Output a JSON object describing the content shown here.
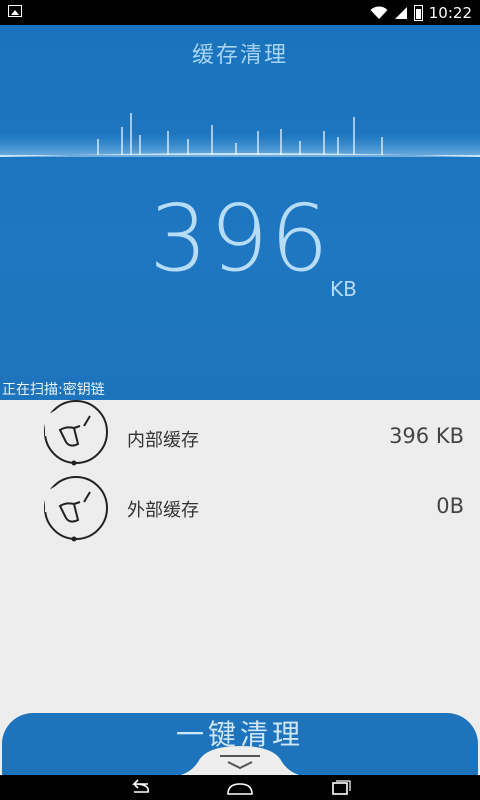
{
  "status_bar": {
    "time": "10:22"
  },
  "header": {
    "title": "缓存清理",
    "size_value": "396",
    "size_unit": "KB",
    "scan_status": "正在扫描:密钥链"
  },
  "list": [
    {
      "label": "内部缓存",
      "value": "396 KB"
    },
    {
      "label": "外部缓存",
      "value": "0B"
    }
  ],
  "clean_button": {
    "label": "一键清理"
  },
  "colors": {
    "accent": "#1e74bc",
    "background": "#ededed"
  }
}
